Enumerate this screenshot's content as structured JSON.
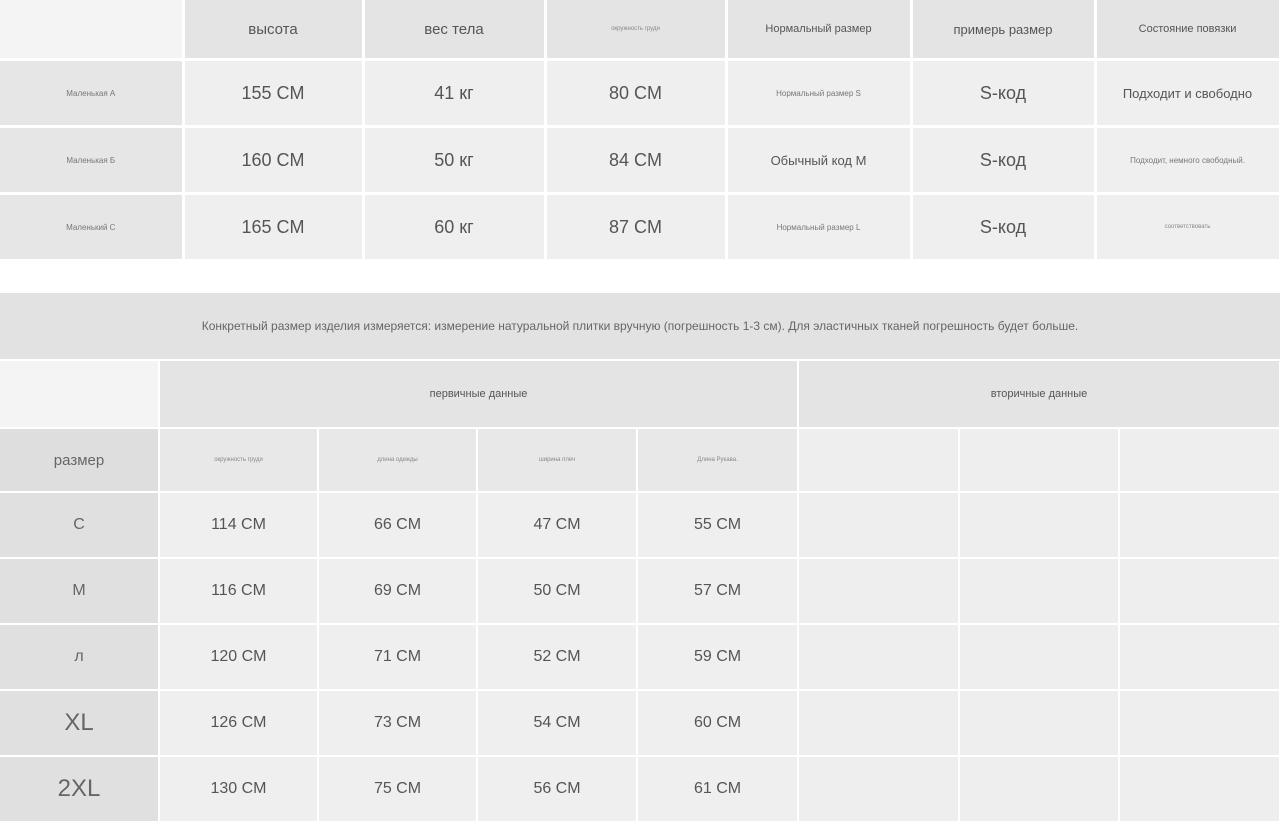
{
  "model_table": {
    "headers": [
      "высота",
      "вес тела",
      "окружность груди",
      "Нормальный размер",
      "примерь размер",
      "Состояние повязки"
    ],
    "rows": [
      {
        "label": "Маленькая A",
        "height": "155 CM",
        "weight": "41 кг",
        "chest": "80 CM",
        "normal_size": "Нормальный размер S",
        "try_size": "S-код",
        "condition": "Подходит и свободно"
      },
      {
        "label": "Маленькая Б",
        "height": "160 CM",
        "weight": "50 кг",
        "chest": "84 CM",
        "normal_size": "Обычный код M",
        "try_size": "S-код",
        "condition": "Подходит, немного свободный."
      },
      {
        "label": "Маленький C",
        "height": "165 CM",
        "weight": "60 кг",
        "chest": "87 CM",
        "normal_size": "Нормальный размер L",
        "try_size": "S-код",
        "condition": "соответствовать"
      }
    ]
  },
  "note": "Конкретный размер изделия измеряется: измерение натуральной плитки вручную (погрешность 1-3 см). Для эластичных тканей погрешность будет больше.",
  "size_table": {
    "primary_label": "первичные данные",
    "secondary_label": "вторичные данные",
    "size_header": "размер",
    "columns": [
      "окружность груди",
      "длина одежды",
      "ширина плеч",
      "Длина Рукава."
    ],
    "rows": [
      {
        "size": "C",
        "values": [
          "114 CM",
          "66 CM",
          "47 CM",
          "55 CM"
        ]
      },
      {
        "size": "M",
        "values": [
          "116 CM",
          "69 CM",
          "50 CM",
          "57 CM"
        ]
      },
      {
        "size": "л",
        "values": [
          "120 CM",
          "71 CM",
          "52 CM",
          "59 CM"
        ]
      },
      {
        "size": "XL",
        "values": [
          "126 CM",
          "73 CM",
          "54 CM",
          "60 CM"
        ]
      },
      {
        "size": "2XL",
        "values": [
          "130 CM",
          "75 CM",
          "56 CM",
          "61 CM"
        ]
      }
    ]
  }
}
